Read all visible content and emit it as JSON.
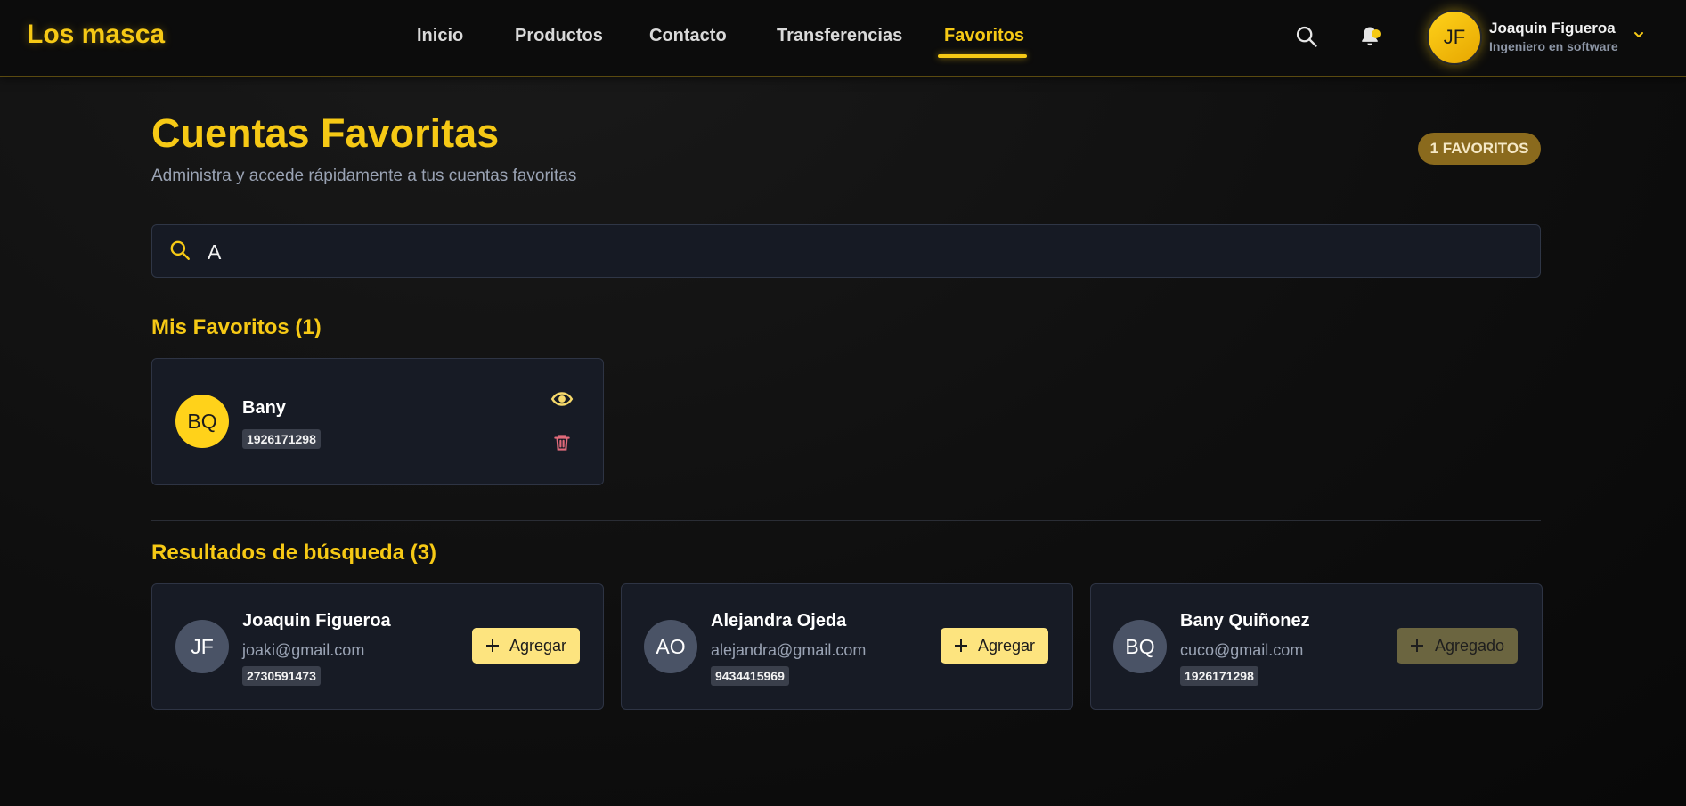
{
  "brand": "Los masca",
  "nav": {
    "items": [
      {
        "label": "Inicio"
      },
      {
        "label": "Productos"
      },
      {
        "label": "Contacto"
      },
      {
        "label": "Transferencias"
      },
      {
        "label": "Favoritos",
        "active": true
      }
    ]
  },
  "header": {
    "icons": [
      "search-icon",
      "bell-icon",
      "chevron-down-icon"
    ],
    "has_notification": true
  },
  "user": {
    "initials": "JF",
    "name": "Joaquin Figueroa",
    "role": "Ingeniero en software"
  },
  "page": {
    "title": "Cuentas Favoritas",
    "subtitle": "Administra y accede rápidamente a tus cuentas favoritas",
    "favorites_badge": "1 FAVORITOS"
  },
  "search": {
    "value": "A"
  },
  "favorites": {
    "title": "Mis Favoritos (1)",
    "items": [
      {
        "initials": "BQ",
        "name": "Bany",
        "account": "1926171298"
      }
    ]
  },
  "results": {
    "title": "Resultados de búsqueda (3)",
    "items": [
      {
        "initials": "JF",
        "name": "Joaquin Figueroa",
        "email": "joaki@gmail.com",
        "account": "2730591473",
        "action": "Agregar",
        "added": false
      },
      {
        "initials": "AO",
        "name": "Alejandra Ojeda",
        "email": "alejandra@gmail.com",
        "account": "9434415969",
        "action": "Agregar",
        "added": false
      },
      {
        "initials": "BQ",
        "name": "Bany Quiñonez",
        "email": "cuco@gmail.com",
        "account": "1926171298",
        "action": "Agregado",
        "added": true
      }
    ]
  },
  "colors": {
    "accent": "#f6c915",
    "background": "#0f0f0f",
    "card": "#171b25",
    "delete": "#e06a7a"
  }
}
